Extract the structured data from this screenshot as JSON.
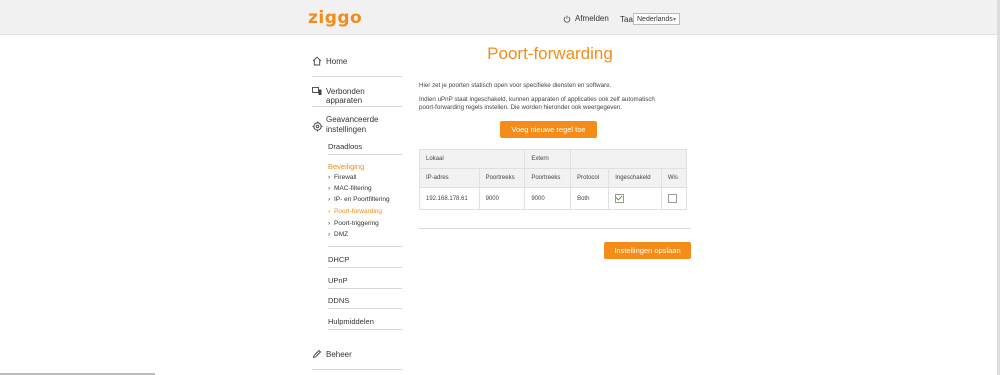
{
  "header": {
    "logo_text": "ziggo",
    "logout_label": "Afmelden",
    "language_label": "Taal",
    "language_selected": "Nederlands"
  },
  "sidebar": {
    "home": "Home",
    "connected_devices": "Verbonden apparaten",
    "advanced_line1": "Geavanceerde",
    "advanced_line2": "instellingen",
    "wireless": "Draadloos",
    "security": "Beveiliging",
    "security_items": [
      "Firewall",
      "MAC-filtering",
      "IP- en Poortfiltering",
      "Poort-forwarding",
      "Poort-triggering",
      "DMZ"
    ],
    "dhcp": "DHCP",
    "upnp": "UPnP",
    "ddns": "DDNS",
    "tools": "Hulpmiddelen",
    "management": "Beheer"
  },
  "main": {
    "title": "Poort-forwarding",
    "desc1": "Hier zet je poorten statisch open voor specifieke diensten en software.",
    "desc2": "Indien uPnP staat ingeschakeld, kunnen apparaten of applicaties ook zelf automatisch",
    "desc3": "poort-forwarding regels instellen. Die worden hieronder ook weergegeven.",
    "add_rule_button": "Voeg nieuwe regel toe",
    "table": {
      "group_local": "Lokaal",
      "group_external": "Extern",
      "headers": [
        "IP-adres",
        "Poortreeks",
        "Poortreeks",
        "Protocol",
        "Ingeschakeld",
        "Wis"
      ],
      "rows": [
        {
          "ip": "192.168.178.61",
          "local_range": "9000",
          "external_range": "9000",
          "protocol": "Both",
          "enabled": true,
          "delete": false
        }
      ]
    },
    "save_button": "Instellingen opslaan"
  },
  "colors": {
    "accent": "#f48c1a",
    "header_bg": "#f1f1f1"
  }
}
